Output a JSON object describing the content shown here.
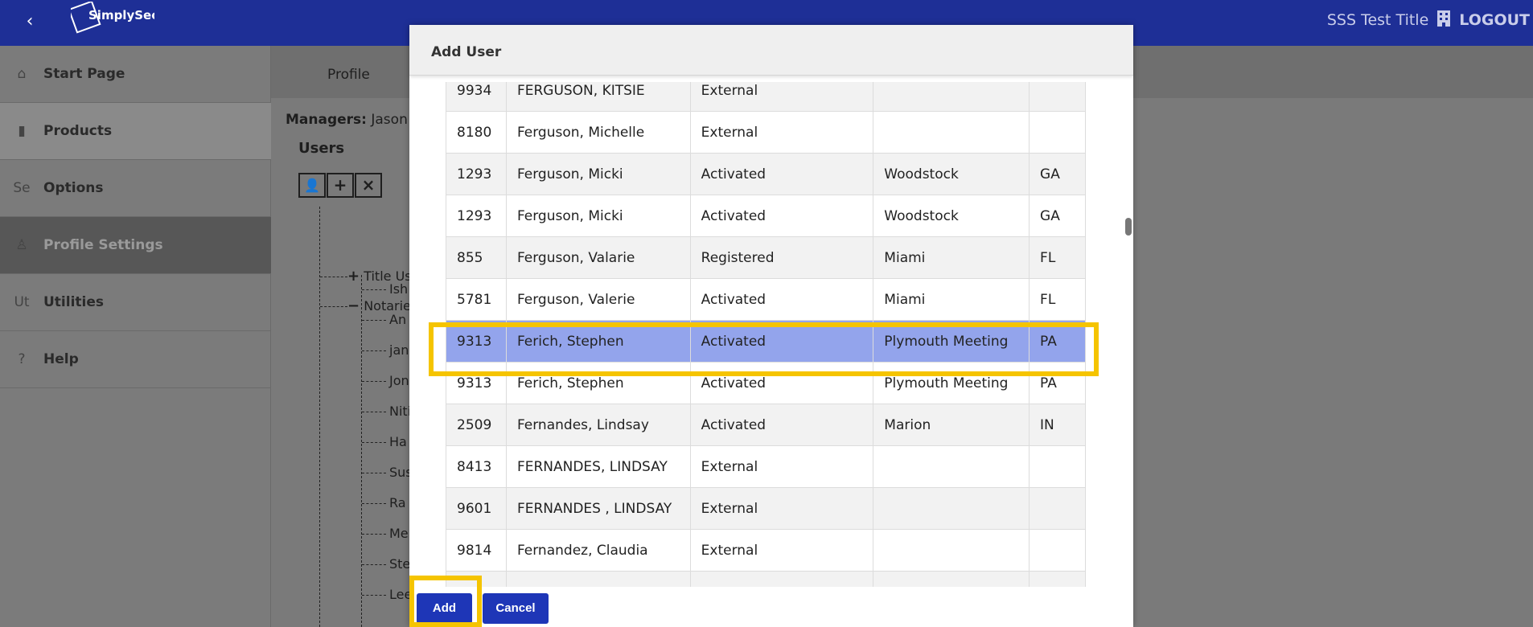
{
  "topbar": {
    "back_icon": "chevron-left-icon",
    "logo_text": "SimplySecureSign",
    "org_title": "SSS Test Title",
    "building_icon": "building-icon",
    "logout_label": "LOGOUT",
    "bg_color": "#1e2f96"
  },
  "sidebar": {
    "items": [
      {
        "icon": "⌂",
        "icon_name": "home-icon",
        "label": "Start Page"
      },
      {
        "icon": "▮",
        "icon_name": "document-icon",
        "label": "Products"
      },
      {
        "icon": "Se",
        "icon_name": "options-icon",
        "label": "Options"
      },
      {
        "icon": "♙",
        "icon_name": "person-icon",
        "label": "Profile Settings"
      },
      {
        "icon": "Ut",
        "icon_name": "utilities-icon",
        "label": "Utilities"
      },
      {
        "icon": "?",
        "icon_name": "help-icon",
        "label": "Help"
      }
    ]
  },
  "main": {
    "tab_profile": "Profile",
    "managers_label": "Managers:",
    "managers_value": "Jason S",
    "users_heading": "Users",
    "toolbar": {
      "user": "👤",
      "add": "+",
      "remove": "×"
    },
    "tree": {
      "title_users": "Title Us",
      "notaries": "Notarie",
      "children": [
        "Ish",
        "An",
        "jan",
        "Jon",
        "Niti",
        "Ha",
        "Sus",
        "Ra",
        "Me",
        "Ste",
        "Lee"
      ]
    }
  },
  "modal": {
    "title": "Add User",
    "rows": [
      {
        "id": "9934",
        "name": "FERGUSON, KITSIE",
        "status": "External",
        "city": "",
        "state": ""
      },
      {
        "id": "8180",
        "name": "Ferguson, Michelle",
        "status": "External",
        "city": "",
        "state": ""
      },
      {
        "id": "1293",
        "name": "Ferguson, Micki",
        "status": "Activated",
        "city": "Woodstock",
        "state": "GA"
      },
      {
        "id": "1293",
        "name": "Ferguson, Micki",
        "status": "Activated",
        "city": "Woodstock",
        "state": "GA"
      },
      {
        "id": "855",
        "name": "Ferguson, Valarie",
        "status": "Registered",
        "city": "Miami",
        "state": "FL"
      },
      {
        "id": "5781",
        "name": "Ferguson, Valerie",
        "status": "Activated",
        "city": "Miami",
        "state": "FL"
      },
      {
        "id": "9313",
        "name": "Ferich, Stephen",
        "status": "Activated",
        "city": "Plymouth Meeting",
        "state": "PA"
      },
      {
        "id": "9313",
        "name": "Ferich, Stephen",
        "status": "Activated",
        "city": "Plymouth Meeting",
        "state": "PA"
      },
      {
        "id": "2509",
        "name": "Fernandes, Lindsay",
        "status": "Activated",
        "city": "Marion",
        "state": "IN"
      },
      {
        "id": "8413",
        "name": "FERNANDES, LINDSAY",
        "status": "External",
        "city": "",
        "state": ""
      },
      {
        "id": "9601",
        "name": "FERNANDES , LINDSAY",
        "status": "External",
        "city": "",
        "state": ""
      },
      {
        "id": "9814",
        "name": "Fernandez, Claudia",
        "status": "External",
        "city": "",
        "state": ""
      },
      {
        "id": "",
        "name": "",
        "status": "",
        "city": "",
        "state": ""
      }
    ],
    "add_label": "Add",
    "cancel_label": "Cancel",
    "selected_color": "#93a4ec",
    "highlight_color": "#f5c400",
    "button_color": "#1e36b7"
  }
}
